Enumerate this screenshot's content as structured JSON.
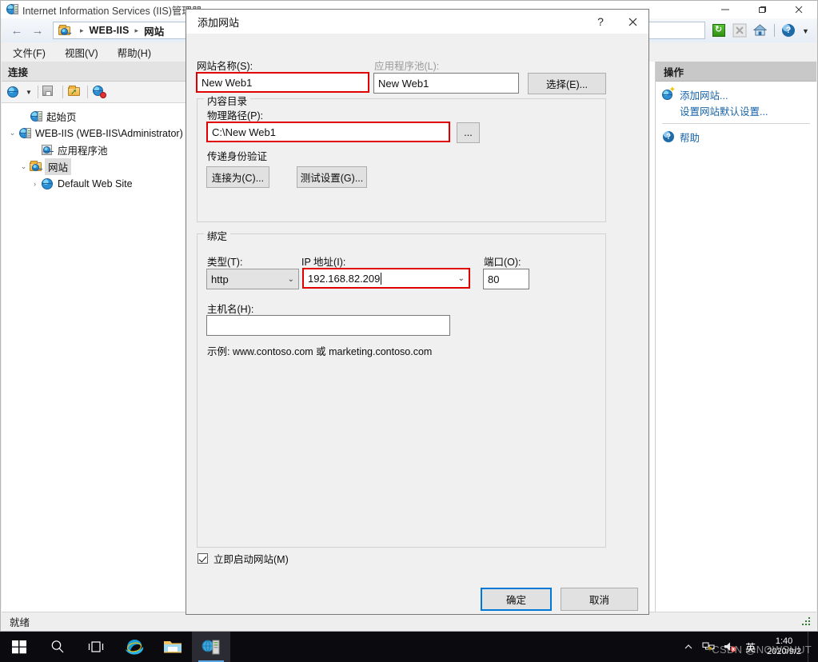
{
  "window": {
    "title": "Internet Information Services (IIS)管理器",
    "title_icon": "iis-server-icon",
    "minimize_label": "—",
    "maximize_label": "❐",
    "close_label": "✕"
  },
  "address": {
    "back_label": "←",
    "forward_label": "→",
    "crumb_icon": "sites-folder-icon",
    "crumbs": [
      "WEB-IIS",
      "网站"
    ],
    "separator": "▸",
    "toolbar_icons": [
      "refresh-icon",
      "stop-icon",
      "home-icon",
      "help-icon",
      "dropdown-icon"
    ]
  },
  "menu": {
    "items": [
      "文件(F)",
      "视图(V)",
      "帮助(H)"
    ]
  },
  "connections": {
    "header": "连接",
    "toolbar_icons": [
      "connect-globe-icon",
      "dropdown-arrow-icon",
      "save-icon",
      "open-icon",
      "disconnect-icon"
    ],
    "tree": [
      {
        "label": "起始页",
        "icon": "start-page-icon",
        "indent": 1,
        "twisty": "",
        "selected": false
      },
      {
        "label": "WEB-IIS (WEB-IIS\\Administrator)",
        "icon": "server-icon",
        "indent": 0,
        "twisty": "⌄",
        "selected": false
      },
      {
        "label": "应用程序池",
        "icon": "app-pool-icon",
        "indent": 2,
        "twisty": "",
        "selected": false
      },
      {
        "label": "网站",
        "icon": "sites-folder-icon",
        "indent": 1,
        "twisty": "⌄",
        "selected": true
      },
      {
        "label": "Default Web Site",
        "icon": "website-globe-icon",
        "indent": 2,
        "twisty": "›",
        "selected": false
      }
    ]
  },
  "actions": {
    "header": "操作",
    "items": [
      {
        "label": "添加网站...",
        "icon": "add-site-icon",
        "has_icon": true
      },
      {
        "label": "设置网站默认设置...",
        "icon": "",
        "has_icon": false
      },
      {
        "label": "帮助",
        "icon": "help-icon",
        "has_icon": true
      }
    ]
  },
  "statusbar": {
    "text": "就绪"
  },
  "dialog": {
    "title": "添加网站",
    "help_label": "?",
    "close_label": "✕",
    "site_name": {
      "label": "网站名称(S):",
      "value": "New Web1"
    },
    "app_pool": {
      "label": "应用程序池(L):",
      "value": "New Web1",
      "select_button": "选择(E)..."
    },
    "content_dir": {
      "legend": "内容目录",
      "physical_path_label": "物理路径(P):",
      "physical_path_value": "C:\\New Web1",
      "browse_button": "...",
      "passthrough_label": "传递身份验证",
      "connect_as_button": "连接为(C)...",
      "test_settings_button": "测试设置(G)..."
    },
    "binding": {
      "legend": "绑定",
      "type_label": "类型(T):",
      "type_value": "http",
      "ip_label": "IP 地址(I):",
      "ip_value": "192.168.82.209",
      "port_label": "端口(O):",
      "port_value": "80",
      "host_label": "主机名(H):",
      "host_value": "",
      "example_text": "示例: www.contoso.com 或 marketing.contoso.com"
    },
    "start_immediately": {
      "label": "立即启动网站(M)",
      "checked": true
    },
    "ok_button": "确定",
    "cancel_button": "取消"
  },
  "taskbar": {
    "items": [
      {
        "name": "start-button",
        "icon": "windows-logo-icon",
        "active": false
      },
      {
        "name": "search-button",
        "icon": "search-icon",
        "active": false
      },
      {
        "name": "task-view-button",
        "icon": "task-view-icon",
        "active": false
      },
      {
        "name": "internet-explorer-button",
        "icon": "internet-explorer-icon",
        "active": false
      },
      {
        "name": "file-explorer-button",
        "icon": "file-explorer-icon",
        "active": false
      },
      {
        "name": "iis-manager-button",
        "icon": "iis-manager-icon",
        "active": true
      }
    ],
    "tray": {
      "expand_label": "︿",
      "network_icon": "network-warning-icon",
      "volume_icon": "volume-muted-icon",
      "ime_label": "英",
      "time": "1:40",
      "date": "2020/9/2"
    }
  },
  "watermark": "CSDN @NOWSHUT",
  "colors": {
    "accent": "#0078d7",
    "highlight_red": "#e00000",
    "link": "#1763a8",
    "taskbar_bg": "#0a0a0f"
  }
}
